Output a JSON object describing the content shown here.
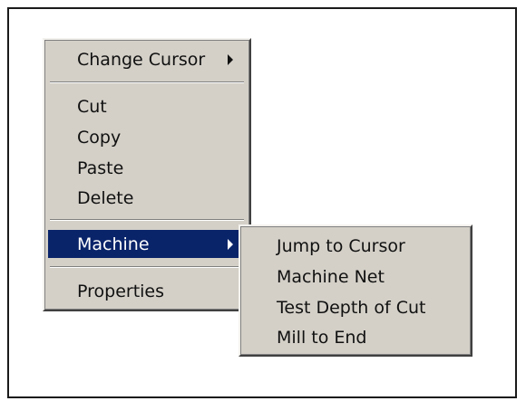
{
  "context_menu": {
    "items": [
      {
        "label": "Change Cursor",
        "has_submenu": true
      },
      {
        "label": "Cut"
      },
      {
        "label": "Copy"
      },
      {
        "label": "Paste"
      },
      {
        "label": "Delete"
      },
      {
        "label": "Machine",
        "has_submenu": true,
        "highlighted": true
      },
      {
        "label": "Properties"
      }
    ]
  },
  "submenu": {
    "items": [
      {
        "label": "Jump to Cursor"
      },
      {
        "label": "Machine Net"
      },
      {
        "label": "Test Depth of Cut"
      },
      {
        "label": "Mill to End"
      }
    ]
  },
  "colors": {
    "menu_bg": "#d4d0c8",
    "highlight_bg": "#0a246a",
    "highlight_text": "#ffffff",
    "text": "#111111"
  }
}
